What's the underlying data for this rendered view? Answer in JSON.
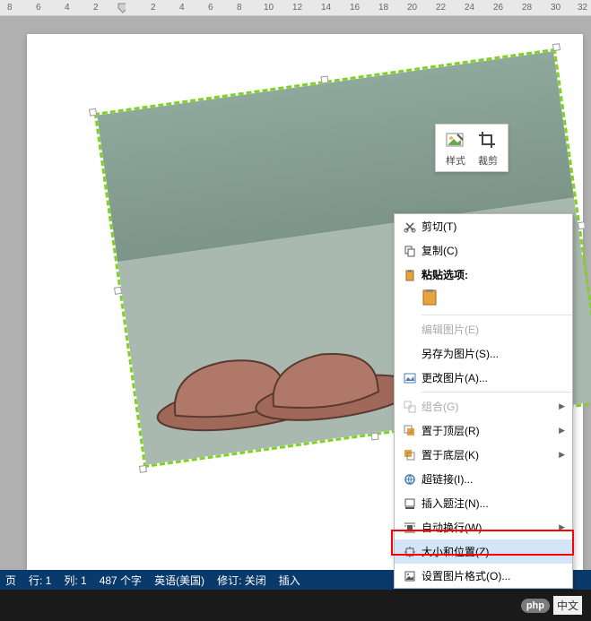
{
  "ruler": {
    "numbers": [
      "8",
      "6",
      "4",
      "2",
      "",
      "2",
      "4",
      "6",
      "8",
      "10",
      "12",
      "14",
      "16",
      "18",
      "20",
      "22",
      "24",
      "26",
      "28",
      "30",
      "32"
    ]
  },
  "anchor": "⚓",
  "float_toolbar": {
    "style_label": "样式",
    "crop_label": "裁剪"
  },
  "context_menu": {
    "cut": "剪切(T)",
    "copy": "复制(C)",
    "paste_options": "粘贴选项:",
    "edit_picture": "编辑图片(E)",
    "save_as_picture": "另存为图片(S)...",
    "change_picture": "更改图片(A)...",
    "group": "组合(G)",
    "bring_to_front": "置于顶层(R)",
    "send_to_back": "置于底层(K)",
    "hyperlink": "超链接(I)...",
    "insert_caption": "插入题注(N)...",
    "auto_wrap": "自动换行(W)",
    "size_position": "大小和位置(Z)...",
    "format_picture": "设置图片格式(O)..."
  },
  "statusbar": {
    "page": "页",
    "line": "行: 1",
    "column": "列: 1",
    "words": "487 个字",
    "language": "英语(美国)",
    "track": "修订: 关闭",
    "insert": "插入"
  },
  "footer": {
    "php": "php",
    "cn": "中文"
  }
}
